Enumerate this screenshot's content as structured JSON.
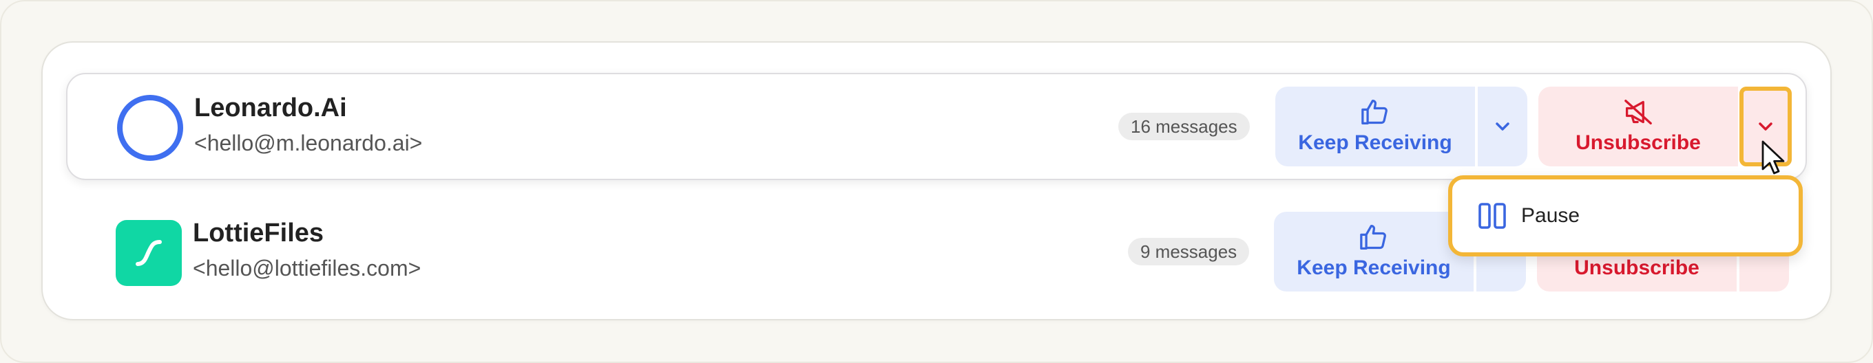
{
  "senders": [
    {
      "name": "Leonardo.Ai",
      "email": "<hello@m.leonardo.ai>",
      "message_count": "16 messages",
      "avatar_icon": "ring-logo-icon",
      "avatar_color": "#3f6ff0"
    },
    {
      "name": "LottieFiles",
      "email": "<hello@lottiefiles.com>",
      "message_count": "9 messages",
      "avatar_icon": "lottie-logo-icon",
      "avatar_color": "#10d7a4"
    }
  ],
  "actions": {
    "keep_label": "Keep Receiving",
    "unsubscribe_label": "Unsubscribe",
    "keep_icon": "thumbs-up-icon",
    "unsubscribe_icon": "megaphone-off-icon",
    "dropdown_icon": "chevron-down-icon"
  },
  "dropdown_menu": {
    "items": [
      {
        "label": "Pause",
        "icon": "pause-icon"
      }
    ]
  },
  "colors": {
    "keep_bg": "#e7edfc",
    "keep_text": "#3a66e0",
    "unsubscribe_bg": "#fde8e9",
    "unsubscribe_text": "#d8192e",
    "highlight": "#f3b637"
  }
}
